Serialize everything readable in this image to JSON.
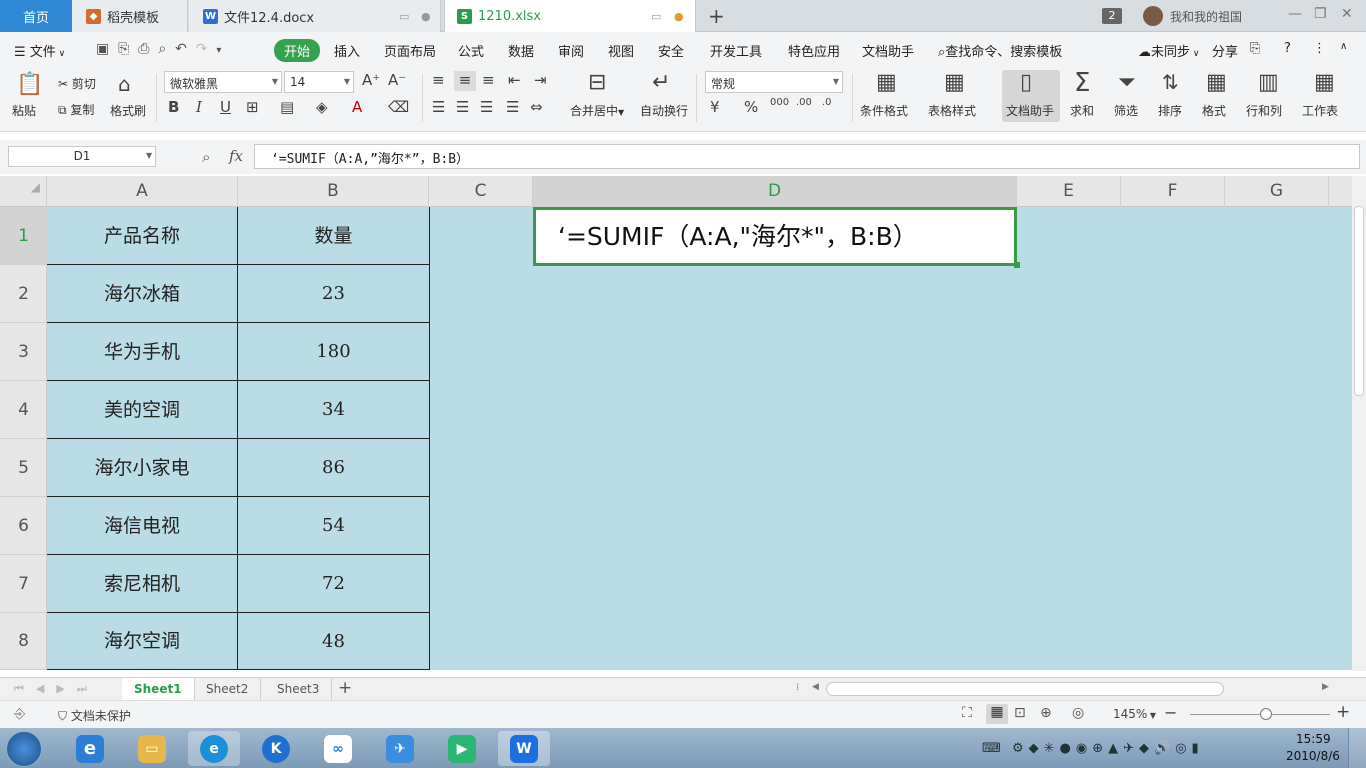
{
  "tabs": {
    "home": "首页",
    "template": "稻壳模板",
    "doc": "文件12.4.docx",
    "active": "1210.xlsx",
    "new_icon": "+",
    "badge": "2",
    "user": "我和我的祖国"
  },
  "menu": {
    "file": "文件",
    "items": [
      "开始",
      "插入",
      "页面布局",
      "公式",
      "数据",
      "审阅",
      "视图",
      "安全",
      "开发工具",
      "特色应用",
      "文档助手"
    ],
    "search": "查找命令、搜索模板",
    "sync": "未同步",
    "share": "分享",
    "help": "?"
  },
  "ribbon": {
    "paste": "粘贴",
    "cut": "剪切",
    "copy": "复制",
    "format_painter": "格式刷",
    "font": "微软雅黑",
    "size": "14",
    "bold": "B",
    "italic": "I",
    "underline": "U",
    "merge": "合并居中",
    "wrap": "自动换行",
    "number_format": "常规",
    "percent": "%",
    "cond_format": "条件格式",
    "table_style": "表格样式",
    "doc_helper": "文档助手",
    "sum": "求和",
    "filter": "筛选",
    "sort": "排序",
    "format": "格式",
    "rowcol": "行和列",
    "sheet": "工作表"
  },
  "formula": {
    "name_box": "D1",
    "fx": "fx",
    "content": "‘=SUMIF（A:A,”海尔*”，B:B）"
  },
  "columns": [
    "A",
    "B",
    "C",
    "D",
    "E",
    "F",
    "G"
  ],
  "rows": [
    "1",
    "2",
    "3",
    "4",
    "5",
    "6",
    "7",
    "8"
  ],
  "table": {
    "header": {
      "a": "产品名称",
      "b": "数量"
    },
    "rows": [
      {
        "a": "海尔冰箱",
        "b": "23"
      },
      {
        "a": "华为手机",
        "b": "180"
      },
      {
        "a": "美的空调",
        "b": "34"
      },
      {
        "a": "海尔小家电",
        "b": "86"
      },
      {
        "a": "海信电视",
        "b": "54"
      },
      {
        "a": "索尼相机",
        "b": "72"
      },
      {
        "a": "海尔空调",
        "b": "48"
      }
    ]
  },
  "d1": "‘=SUMIF（A:A,\"海尔*\"，B:B）",
  "sheets": [
    "Sheet1",
    "Sheet2",
    "Sheet3"
  ],
  "status": {
    "protect": "文档未保护",
    "zoom": "145%"
  },
  "taskbar": {
    "time": "15:59",
    "date": "2010/8/6"
  },
  "colors": {
    "accent": "#37a24d",
    "grid_fill": "#b9dce6",
    "selection": "#3a9a47",
    "home_tab": "#2f88d4"
  }
}
